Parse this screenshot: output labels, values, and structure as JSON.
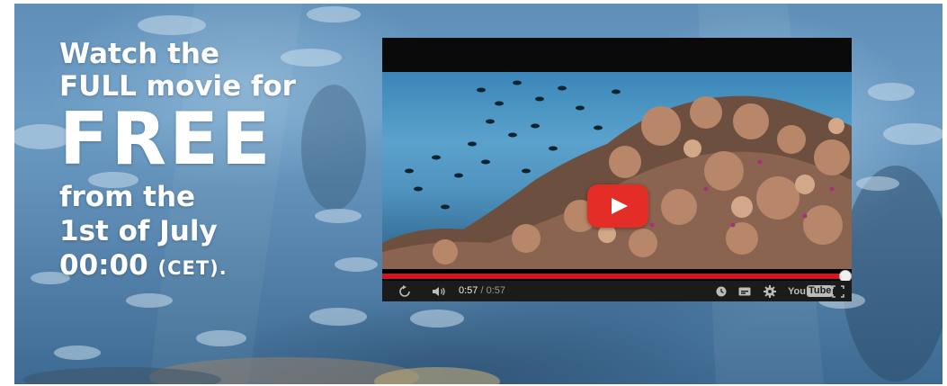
{
  "headline": {
    "line1": "Watch the",
    "line2": "FULL movie for",
    "line3": "FREE",
    "line4": "from the",
    "line5": "1st of July",
    "line6_time": "00:00",
    "line6_zone": "(CET)."
  },
  "player": {
    "current_time": "0:57",
    "separator": " / ",
    "duration": "0:57",
    "progress_fraction": 1.0,
    "logo_you": "You",
    "logo_tube": "Tube",
    "play_button_color": "#e52d27",
    "progress_color": "#cc181e"
  },
  "icons": {
    "replay": "replay-icon",
    "volume": "volume-icon",
    "watch_later": "clock-icon",
    "captions": "captions-icon",
    "settings": "gear-icon",
    "fullscreen": "fullscreen-icon"
  }
}
